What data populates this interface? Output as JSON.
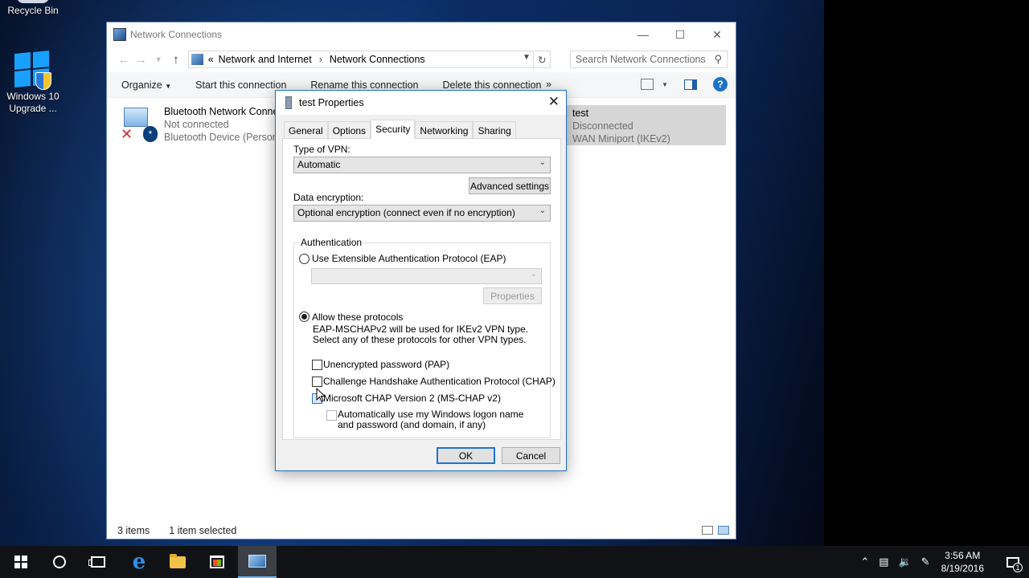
{
  "desktop": {
    "icons": [
      {
        "label": "Recycle Bin"
      },
      {
        "label": "Windows 10 Upgrade ..."
      }
    ]
  },
  "explorer": {
    "title": "Network Connections",
    "breadcrumb": {
      "overflow": "«",
      "items": [
        "Network and Internet",
        "Network Connections"
      ]
    },
    "search_placeholder": "Search Network Connections",
    "commands": [
      "Organize",
      "Start this connection",
      "Rename this connection",
      "Delete this connection"
    ],
    "more_commands": "»",
    "connections": [
      {
        "name": "Bluetooth Network Conne",
        "status": "Not connected",
        "device": "Bluetooth Device (Persona",
        "selected": false
      },
      {
        "name": "test",
        "status": "Disconnected",
        "device": "WAN Miniport (IKEv2)",
        "selected": true
      }
    ],
    "status": {
      "items": "3 items",
      "selected": "1 item selected"
    }
  },
  "dialog": {
    "title": "test Properties",
    "tabs": [
      "General",
      "Options",
      "Security",
      "Networking",
      "Sharing"
    ],
    "active_tab": "Security",
    "vpn_type_label": "Type of VPN:",
    "vpn_type_value": "Automatic",
    "advanced_button": "Advanced settings",
    "encryption_label": "Data encryption:",
    "encryption_value": "Optional encryption (connect even if no encryption)",
    "auth_legend": "Authentication",
    "eap_option": "Use Extensible Authentication Protocol (EAP)",
    "eap_selected": false,
    "eap_properties_button": "Properties",
    "protocols_option": "Allow these protocols",
    "protocols_selected": true,
    "protocols_desc": "EAP-MSCHAPv2 will be used for IKEv2 VPN type. Select any of these protocols for other VPN types.",
    "checkboxes": [
      {
        "label": "Unencrypted password (PAP)",
        "checked": false
      },
      {
        "label": "Challenge Handshake Authentication Protocol (CHAP)",
        "checked": false
      },
      {
        "label": "Microsoft CHAP Version 2 (MS-CHAP v2)",
        "checked": false
      }
    ],
    "auto_logon": "Automatically use my Windows logon name and password (and domain, if any)",
    "ok_button": "OK",
    "cancel_button": "Cancel"
  },
  "taskbar": {
    "time": "3:56 AM",
    "date": "8/19/2016",
    "notifications": "1",
    "apps": [
      "start",
      "search",
      "task-view",
      "edge",
      "file-explorer",
      "store",
      "network-connections"
    ]
  },
  "colors": {
    "accent": "#1e73d0",
    "selection": "#d6d6d6"
  }
}
